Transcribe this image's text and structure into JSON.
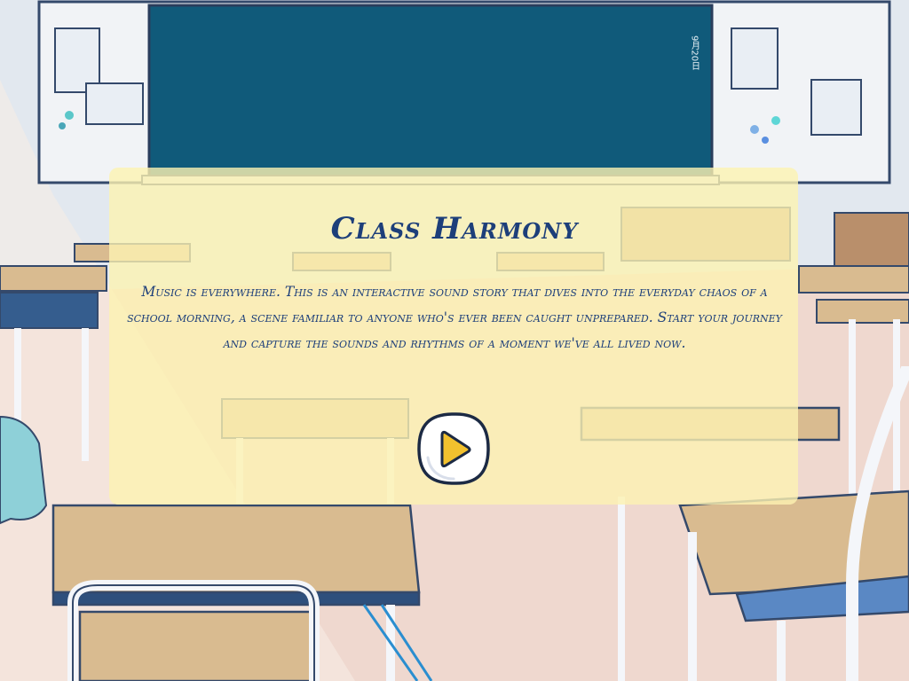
{
  "app": {
    "title": "Class Harmony",
    "description": "Music is everywhere. This is an interactive sound story that dives into the everyday chaos of a school morning, a scene familiar to anyone who's ever been caught unprepared. Start your journey and capture the sounds and rhythms of a moment we've all lived now."
  },
  "scene": {
    "chalkboard_date": "9月20日"
  },
  "controls": {
    "play_icon": "play-icon"
  },
  "colors": {
    "title_text": "#1d3f7a",
    "card_background": "#fcf3b2",
    "chalkboard": "#105a7a",
    "play_triangle": "#f2c12e"
  }
}
